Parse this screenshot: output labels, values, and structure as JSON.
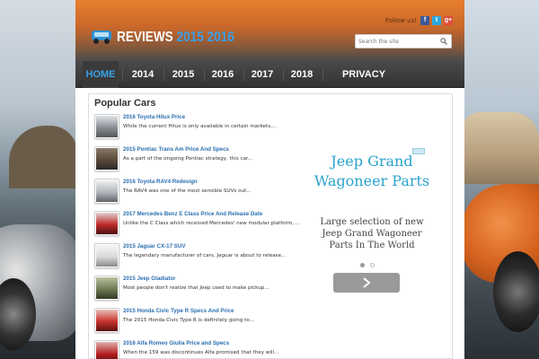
{
  "site": {
    "logo_main": "REVIEWS ",
    "logo_years": "2015 2016",
    "follow_label": "Follow us!",
    "social": [
      "f",
      "t",
      "g+"
    ],
    "search_placeholder": "Search the site"
  },
  "nav": {
    "items": [
      {
        "label": "HOME",
        "active": true
      },
      {
        "label": "2014"
      },
      {
        "label": "2015"
      },
      {
        "label": "2016"
      },
      {
        "label": "2017"
      },
      {
        "label": "2018"
      },
      {
        "label": "PRIVACY POLICY"
      }
    ]
  },
  "popular": {
    "title": "Popular Cars",
    "items": [
      {
        "title": "2016 Toyota Hilux Price",
        "desc": "While the current Hilux is only available in certain markets,...",
        "color": "#8a8f95"
      },
      {
        "title": "2015 Pontiac Trans Am Price And Specs",
        "desc": "As a part of the ongoing Pontiac strategy, this car...",
        "color": "#5a4a3a"
      },
      {
        "title": "2016 Toyota RAV4 Redesign",
        "desc": "The RAV4 was one of the most sensible SUVs out...",
        "color": "#b0b6bb"
      },
      {
        "title": "2017 Mercedes Benz E Class Price And Release Date",
        "desc": "Unlike the C Class which received Mercedes' new modular platform, ...",
        "color": "#c02a2a"
      },
      {
        "title": "2015 Jaguar CX-17 SUV",
        "desc": "The legendary manufacturer of cars, Jaguar is about to release...",
        "color": "#d9d9d9"
      },
      {
        "title": "2015 Jeep Gladiator",
        "desc": "Most people don't realize that Jeep used to make pickup...",
        "color": "#6f7a55"
      },
      {
        "title": "2015 Honda Civic Type R Specs And Price",
        "desc": "The 2015 Honda Civic Type R is definitely going to...",
        "color": "#c8302a"
      },
      {
        "title": "2016 Alfa Romeo Giulia Price and Specs",
        "desc": "When the 159 was discontinues Alfa promised that they will...",
        "color": "#b52020"
      }
    ]
  },
  "ad": {
    "headline": "Jeep Grand Wagoneer Parts",
    "body": "Large selection of new Jeep Grand Wagoneer Parts In The World",
    "arrow": "›"
  }
}
